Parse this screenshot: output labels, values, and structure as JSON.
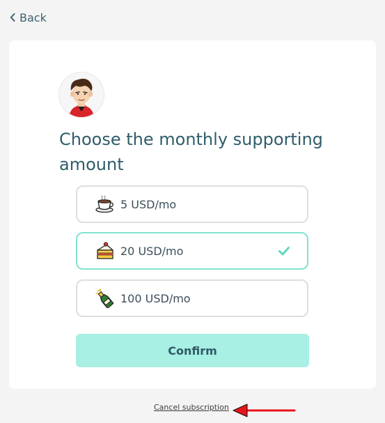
{
  "nav": {
    "back_label": "Back"
  },
  "card": {
    "title": "Choose the monthly supporting amount",
    "options": [
      {
        "label": "5 USD/mo",
        "icon": "coffee-icon",
        "selected": false
      },
      {
        "label": "20 USD/mo",
        "icon": "cake-icon",
        "selected": true
      },
      {
        "label": "100 USD/mo",
        "icon": "champagne-icon",
        "selected": false
      }
    ],
    "confirm_label": "Confirm"
  },
  "footer": {
    "cancel_label": "Cancel subscription"
  },
  "colors": {
    "accent": "#7fe3cf",
    "confirm_bg": "#a8efe4",
    "title": "#2f5d6b",
    "annotation_arrow": "#e8141c"
  }
}
